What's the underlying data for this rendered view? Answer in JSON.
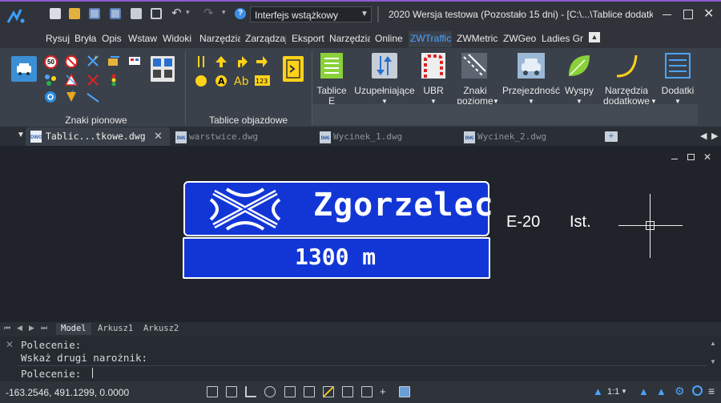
{
  "title": {
    "workspace": "Interfejs wstążkowy",
    "window_title": "2020 Wersja testowa (Pozostało 15 dni) - [C:\\...\\Tablice dodatkc"
  },
  "menu": [
    "Rysuj",
    "Bryła",
    "Opis",
    "Wstaw",
    "Widoki",
    "Narzędzia",
    "Zarządzaj",
    "Eksport",
    "Narzędzia",
    "Online",
    "ZWTraffic",
    "ZWMetric",
    "ZWGeo",
    "Ladies Gr"
  ],
  "ribbon": {
    "groups": [
      "Znaki pionowe",
      "Tablice objazdowe"
    ],
    "small_sign_label": "50",
    "buttons": [
      {
        "line1": "Tablice",
        "line2": "E"
      },
      {
        "line1": "Uzupełniające",
        "line2": ""
      },
      {
        "line1": "UBR",
        "line2": ""
      },
      {
        "line1": "Znaki",
        "line2": "poziome"
      },
      {
        "line1": "Przejezdność",
        "line2": ""
      },
      {
        "line1": "Wyspy",
        "line2": ""
      },
      {
        "line1": "Narzędzia",
        "line2": "dodatkowe"
      },
      {
        "line1": "Dodatki",
        "line2": ""
      }
    ]
  },
  "doc_tabs": [
    "Tablic...tkowe.dwg",
    "warstwice.dwg",
    "Wycinek_1.dwg",
    "Wycinek_2.dwg"
  ],
  "doc_tab_icon_label": "DWG",
  "drawing": {
    "sign_title": "Zgorzelec",
    "sign_distance": "1300 m",
    "label_e20": "E-20",
    "label_ist": "Ist."
  },
  "layout_tabs": [
    "Model",
    "Arkusz1",
    "Arkusz2"
  ],
  "command": {
    "lines": [
      "Polecenie:",
      "Wskaż drugi narożnik:"
    ],
    "prompt": "Polecenie:"
  },
  "status": {
    "coords": "-163.2546, 491.1299, 0.0000",
    "scale": "1:1"
  },
  "colors": {
    "accent": "#4aa3ff",
    "sign_blue": "#1236d6",
    "ribbon_bg": "#3b414a"
  }
}
